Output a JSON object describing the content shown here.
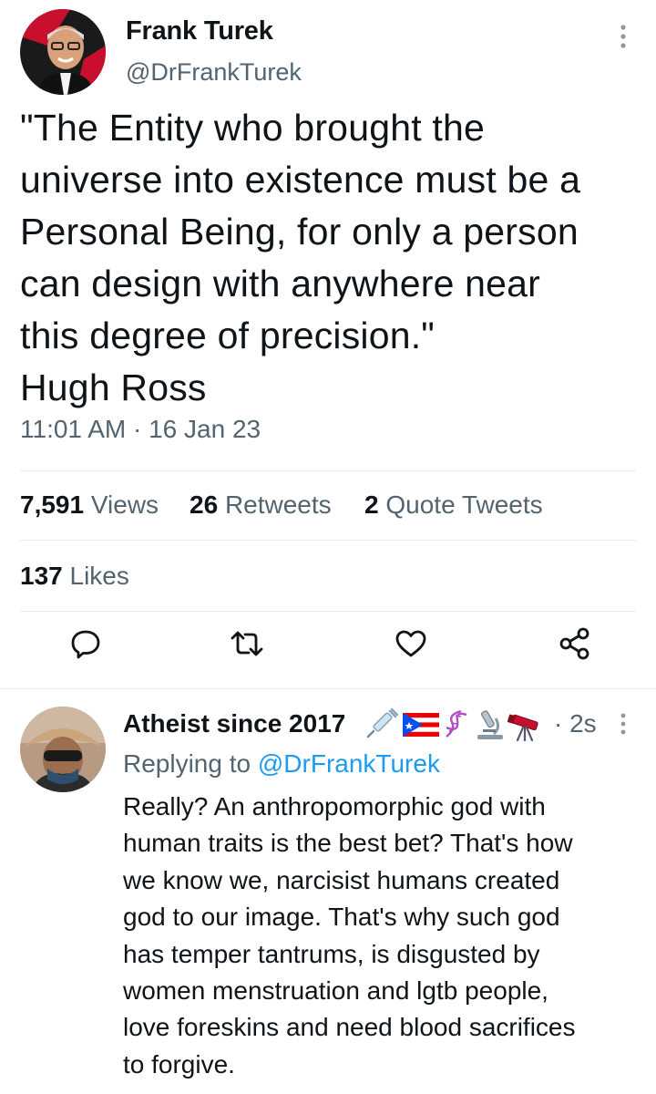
{
  "tweet": {
    "author_name": "Frank Turek",
    "author_handle": "@DrFrankTurek",
    "text_lines": [
      "\"The Entity who brought the",
      "universe into existence must be a",
      "Personal Being, for only a person",
      "can design with anywhere near",
      "this degree of precision.\"",
      "Hugh Ross"
    ],
    "timestamp": "11:01 AM · 16 Jan 23",
    "stats": {
      "views_count": "7,591",
      "views_label": "Views",
      "retweets_count": "26",
      "retweets_label": "Retweets",
      "quotes_count": "2",
      "quotes_label": "Quote Tweets",
      "likes_count": "137",
      "likes_label": "Likes"
    },
    "actions": [
      "reply-icon",
      "retweet-icon",
      "like-icon",
      "share-icon"
    ]
  },
  "reply": {
    "author_name": "Atheist since 2017",
    "emoji_icons": [
      "syringe-icon",
      "puerto-rico-flag-icon",
      "dna-icon",
      "microscope-icon",
      "telescope-icon"
    ],
    "time": "· 2s",
    "replying_prefix": "Replying to",
    "replying_handle": "@DrFrankTurek",
    "text_lines": [
      "Really? An anthropomorphic god with",
      "human traits is the best bet? That's how",
      "we know we, narcisist humans created",
      "god to our image. That's why such god",
      "has temper tantrums, is disgusted by",
      "women menstruation and lgtb people,",
      "love foreskins and need blood sacrifices",
      "to forgive."
    ]
  },
  "colors": {
    "text": "#0f1419",
    "secondary": "#536471",
    "accent": "#1d9bf0",
    "divider": "#e6ecf0"
  }
}
